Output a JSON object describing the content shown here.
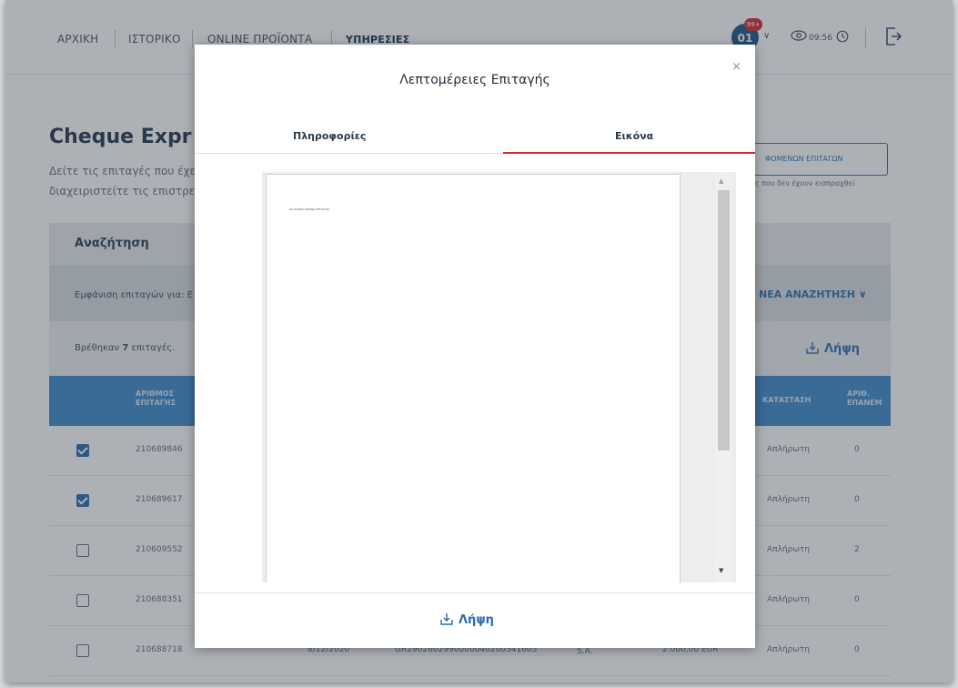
{
  "nav": {
    "items": [
      "ΑΡΧΙΚΗ",
      "ΙΣΤΟΡΙΚΟ",
      "ONLINE ΠΡΟΪΟΝΤΑ",
      "ΥΠΗΡΕΣΙΕΣ"
    ],
    "avatar_initials": "01",
    "avatar_badge": "99+",
    "session_timer": "09:56"
  },
  "page": {
    "title": "Cheque Expr",
    "description": "Δείτε τις επιταγές που έχε διαχειριστείτε τις επιστρε",
    "returned_button": "ΦΟΜΕΝΩΝ ΕΠΙΤΑΓΩΝ",
    "returned_note": "ς που δεν έχουν εισπραχθεί",
    "search_title": "Αναζήτηση",
    "show_label": "Εμφάνιση επιταγών για: Ε",
    "new_search": "ΝΕΑ ΑΝΑΖΗΤΗΣΗ ∨",
    "found_prefix": "Βρέθηκαν ",
    "found_count": "7",
    "found_suffix": " επιταγές.",
    "download_label": "Λήψη"
  },
  "table": {
    "headers": {
      "number": "ΑΡΙΘΜΟΣ ΕΠΙΤΑΓΗΣ",
      "status": "ΚΑΤΑΣΤΑΣΗ",
      "representations": "ΑΡΙΘ. ΕΠΑΝΕΜ"
    },
    "rows": [
      {
        "checked": true,
        "number": "210689846",
        "date": "",
        "iban": "",
        "bank": "",
        "amount": "",
        "status": "Απλήρωτη",
        "count": "0"
      },
      {
        "checked": true,
        "number": "210689617",
        "date": "",
        "iban": "",
        "bank": "",
        "amount": "",
        "status": "Απλήρωτη",
        "count": "0"
      },
      {
        "checked": false,
        "number": "210609552",
        "date": "",
        "iban": "",
        "bank": "",
        "amount": "",
        "status": "Απλήρωτη",
        "count": "2"
      },
      {
        "checked": false,
        "number": "210688351",
        "date": "",
        "iban": "",
        "bank": "",
        "amount": "",
        "status": "Απλήρωτη",
        "count": "0"
      },
      {
        "checked": false,
        "number": "210688718",
        "date": "8/12/2020",
        "iban": "GR2902602990000040200541605",
        "bank": "EUROBANK S.A.",
        "amount": "2.000,00 EUR",
        "status": "Απλήρωτη",
        "count": "0"
      }
    ]
  },
  "modal": {
    "title": "Λεπτομέρειες Επιταγής",
    "tabs": [
      "Πληροφορίες",
      "Εικόνα"
    ],
    "active_tab": "Εικόνα",
    "document_text": "ΔΑ ΕΙΑΙΠΙΑ ΕΙΚΟΝΑ ΕΠΙΤΑΓΗΣ",
    "download_label": "Λήψη",
    "close_glyph": "×"
  },
  "colors": {
    "accent": "#2a6bb0",
    "table_header": "#3a86c8",
    "tab_active": "#d9262e",
    "avatar": "#1b4f86",
    "badge": "#d2242c"
  }
}
